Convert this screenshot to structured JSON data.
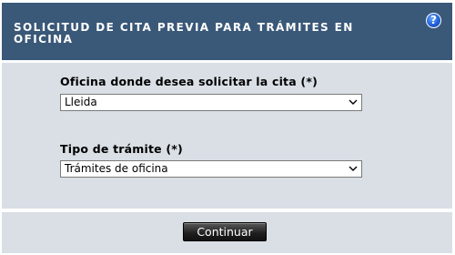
{
  "header": {
    "title": "SOLICITUD DE CITA PREVIA PARA TRÁMITES EN OFICINA",
    "help_icon": "help-icon",
    "help_glyph": "?"
  },
  "form": {
    "office_label": "Oficina donde desea solicitar la cita (*)",
    "office_selected": "Lleida",
    "procedure_label": "Tipo de trámite (*)",
    "procedure_selected": "Trámites de oficina"
  },
  "footer": {
    "continue_label": "Continuar"
  },
  "colors": {
    "header_bg": "#3a5878",
    "panel_bg": "#d9dfe5",
    "button_bg": "#1e1e1e"
  }
}
